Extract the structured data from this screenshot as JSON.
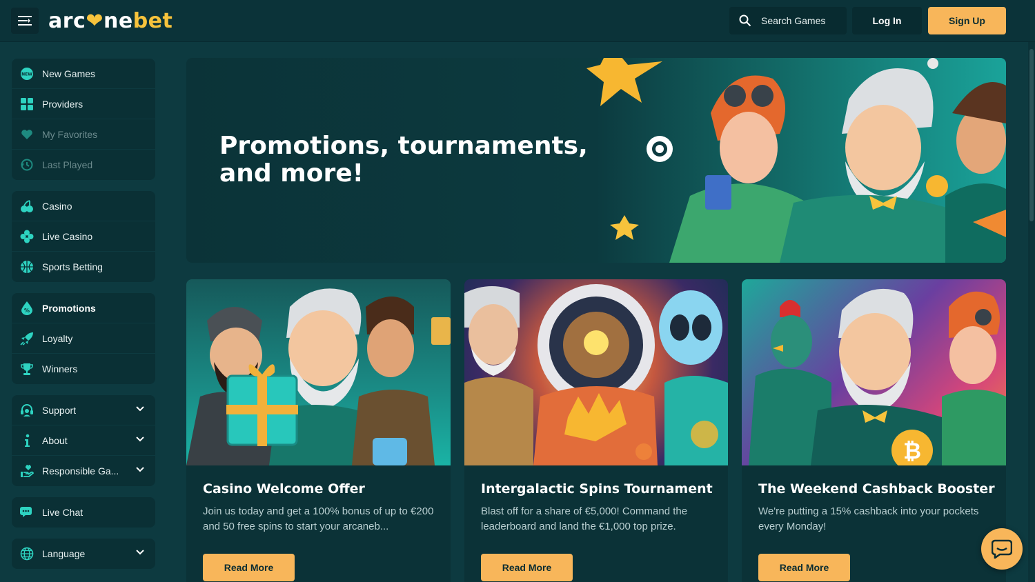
{
  "header": {
    "logo": {
      "part1": "arc",
      "heart": "❤",
      "part2": "ne",
      "part3": "bet"
    },
    "search_label": "Search Games",
    "login_label": "Log In",
    "signup_label": "Sign Up"
  },
  "sidebar": {
    "group1": [
      {
        "label": "New Games",
        "icon": "new-badge-icon"
      },
      {
        "label": "Providers",
        "icon": "grid-icon"
      },
      {
        "label": "My Favorites",
        "icon": "heart-icon"
      },
      {
        "label": "Last Played",
        "icon": "history-icon"
      }
    ],
    "group2": [
      {
        "label": "Casino",
        "icon": "cherry-icon"
      },
      {
        "label": "Live Casino",
        "icon": "clover-icon"
      },
      {
        "label": "Sports Betting",
        "icon": "basketball-icon"
      }
    ],
    "group3": [
      {
        "label": "Promotions",
        "icon": "percent-drop-icon"
      },
      {
        "label": "Loyalty",
        "icon": "rocket-icon"
      },
      {
        "label": "Winners",
        "icon": "trophy-icon"
      }
    ],
    "group4": [
      {
        "label": "Support",
        "icon": "headset-icon"
      },
      {
        "label": "About",
        "icon": "info-icon"
      },
      {
        "label": "Responsible Ga...",
        "icon": "hand-heart-icon"
      }
    ],
    "live_chat": "Live Chat",
    "language": "Language"
  },
  "hero": {
    "title": "Promotions, tournaments, and more!"
  },
  "cards": [
    {
      "title": "Casino Welcome Offer",
      "description": "Join us today and get a 100% bonus of up to €200 and 50 free spins to start your arcaneb...",
      "button": "Read More"
    },
    {
      "title": "Intergalactic Spins Tournament",
      "description": "Blast off for a share of €5,000! Command the leaderboard and land the €1,000 top prize.",
      "button": "Read More"
    },
    {
      "title": "The Weekend Cashback Booster",
      "description": "We're putting a 15% cashback into your pockets every Monday!",
      "button": "Read More"
    }
  ],
  "colors": {
    "accent": "#f8b65a",
    "background": "#0d3a40",
    "panel": "#0a3035",
    "icon_teal": "#2ed3c1"
  }
}
